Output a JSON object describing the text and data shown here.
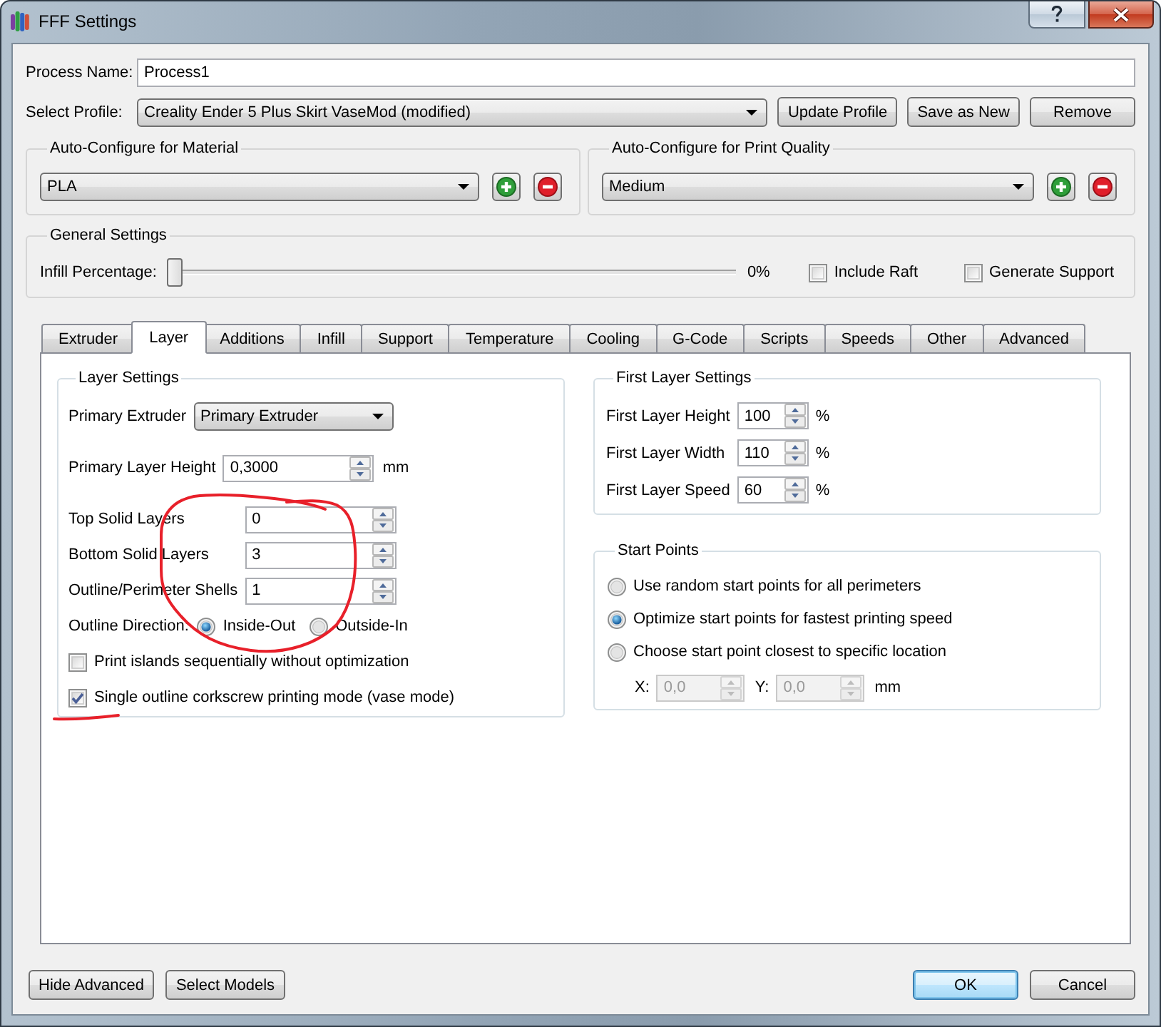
{
  "window": {
    "title": "FFF Settings"
  },
  "process_name": {
    "label": "Process Name:",
    "value": "Process1"
  },
  "profile": {
    "label": "Select Profile:",
    "value": "Creality Ender 5 Plus Skirt VaseMod (modified)",
    "buttons": [
      "Update Profile",
      "Save as New",
      "Remove"
    ]
  },
  "auto_configure": [
    {
      "title": "Auto-Configure for Material",
      "value": "PLA"
    },
    {
      "title": "Auto-Configure for Print Quality",
      "value": "Medium"
    }
  ],
  "general_settings": {
    "title": "General Settings",
    "infill": {
      "label": "Infill Percentage:",
      "level": 0,
      "reading": "0%"
    },
    "options": [
      {
        "label": "Include Raft",
        "checked": false
      },
      {
        "label": "Generate Support",
        "checked": false
      }
    ]
  },
  "tabs": [
    {
      "label": "Extruder",
      "selected": false
    },
    {
      "label": "Layer",
      "selected": true
    },
    {
      "label": "Additions",
      "selected": false
    },
    {
      "label": "Infill",
      "selected": false
    },
    {
      "label": "Support",
      "selected": false
    },
    {
      "label": "Temperature",
      "selected": false
    },
    {
      "label": "Cooling",
      "selected": false
    },
    {
      "label": "G-Code",
      "selected": false
    },
    {
      "label": "Scripts",
      "selected": false
    },
    {
      "label": "Speeds",
      "selected": false
    },
    {
      "label": "Other",
      "selected": false
    },
    {
      "label": "Advanced",
      "selected": false
    }
  ],
  "layer_settings": {
    "title": "Layer Settings",
    "sections": [
      {
        "rows": [
          {
            "kind": "combo",
            "label": "Primary Extruder",
            "value": "Primary Extruder"
          }
        ]
      },
      {
        "rows": [
          {
            "kind": "spin",
            "label": "Primary Layer Height",
            "value": "0,3000",
            "unit": "mm"
          }
        ]
      },
      {
        "rows": [
          {
            "kind": "spin",
            "label": "Top Solid Layers",
            "value": "0"
          },
          {
            "kind": "spin",
            "label": "Bottom Solid Layers",
            "value": "3"
          },
          {
            "kind": "spin",
            "label": "Outline/Perimeter Shells",
            "value": "1"
          },
          {
            "kind": "radio",
            "label": "Outline Direction:",
            "options": [
              {
                "label": "Inside-Out",
                "selected": true
              },
              {
                "label": "Outside-In",
                "selected": false
              }
            ]
          },
          {
            "kind": "checkbox",
            "label": "Print islands sequentially without optimization",
            "checked": false
          },
          {
            "kind": "checkbox",
            "label": "Single outline corkscrew printing mode (vase mode)",
            "checked": true
          }
        ]
      }
    ]
  },
  "first_layer_settings": {
    "title": "First Layer Settings",
    "rows": [
      {
        "label": "First Layer Height",
        "value": "100",
        "unit": "%"
      },
      {
        "label": "First Layer Width",
        "value": "110",
        "unit": "%"
      },
      {
        "label": "First Layer Speed",
        "value": "60",
        "unit": "%"
      }
    ]
  },
  "start_points": {
    "title": "Start Points",
    "options": [
      {
        "label": "Use random start points for all perimeters",
        "selected": false
      },
      {
        "label": "Optimize start points for fastest printing speed",
        "selected": true
      },
      {
        "label": "Choose start point closest to specific location",
        "selected": false
      }
    ],
    "location": {
      "disabled": true,
      "fields": [
        {
          "label": "X:",
          "value": "0,0"
        },
        {
          "label": "Y:",
          "value": "0,0"
        }
      ],
      "unit": "mm"
    }
  },
  "footer": {
    "left_buttons": [
      "Hide Advanced",
      "Select Models"
    ],
    "right_buttons": [
      {
        "label": "OK",
        "default": true
      },
      {
        "label": "Cancel",
        "default": false
      }
    ]
  }
}
